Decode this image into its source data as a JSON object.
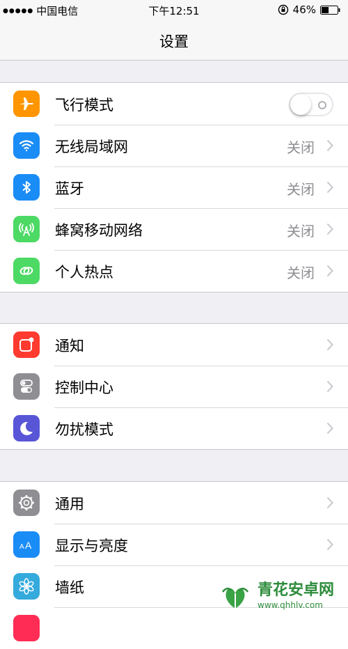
{
  "status_bar": {
    "signal": "●●●●●",
    "carrier": "中国电信",
    "time": "下午12:51",
    "battery_percent": "46%",
    "battery_level": 0.46
  },
  "nav": {
    "title": "设置"
  },
  "groups": [
    {
      "items": [
        {
          "label": "飞行模式",
          "icon": "airplane-icon",
          "icon_color": "#ff9500",
          "control": "toggle",
          "toggle_on": false
        },
        {
          "label": "无线局域网",
          "icon": "wifi-icon",
          "icon_color": "#1a8cf6",
          "value": "关闭"
        },
        {
          "label": "蓝牙",
          "icon": "bluetooth-icon",
          "icon_color": "#1a8cf6",
          "value": "关闭"
        },
        {
          "label": "蜂窝移动网络",
          "icon": "cellular-antenna-icon",
          "icon_color": "#4cd964",
          "value": "关闭"
        },
        {
          "label": "个人热点",
          "icon": "hotspot-link-icon",
          "icon_color": "#4cd964",
          "value": "关闭"
        }
      ]
    },
    {
      "items": [
        {
          "label": "通知",
          "icon": "notifications-icon",
          "icon_color": "#ff3b30"
        },
        {
          "label": "控制中心",
          "icon": "control-center-icon",
          "icon_color": "#8e8e93"
        },
        {
          "label": "勿扰模式",
          "icon": "moon-icon",
          "icon_color": "#5856d6"
        }
      ]
    },
    {
      "items": [
        {
          "label": "通用",
          "icon": "gear-icon",
          "icon_color": "#8e8e93"
        },
        {
          "label": "显示与亮度",
          "icon": "text-size-icon",
          "icon_color": "#1a8cf6"
        },
        {
          "label": "墙纸",
          "icon": "flower-icon",
          "icon_color": "#35aadc"
        },
        {
          "label": "",
          "icon": "partial-icon",
          "icon_color": "#ff2d55"
        }
      ]
    }
  ],
  "watermark": {
    "text": "青花安卓网",
    "url": "www.qhhlv.com"
  }
}
